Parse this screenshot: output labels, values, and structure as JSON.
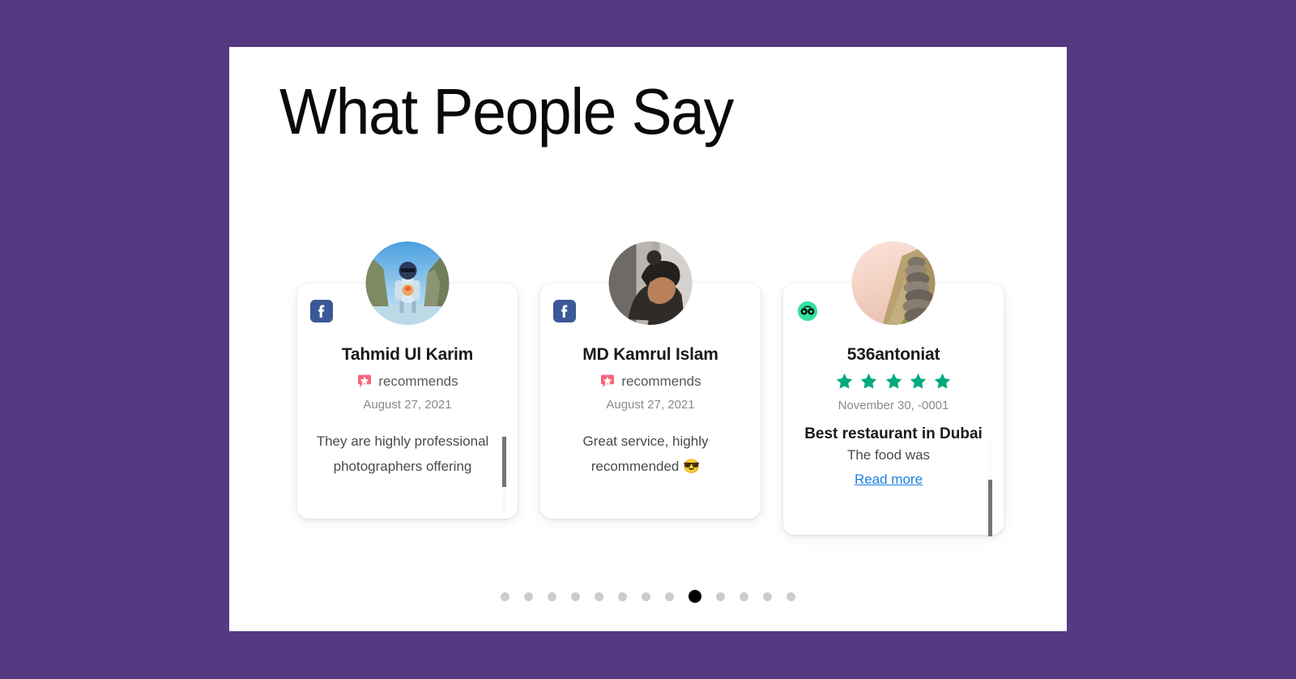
{
  "theme": {
    "background_color": "#553a82",
    "panel_color": "#ffffff",
    "facebook_blue": "#3b5998",
    "tripadvisor_green": "#34e0a1",
    "star_green": "#00a97f",
    "recommend_pink": "#f8657a",
    "link_blue": "#1b7fe0",
    "active_dot_color": "#000000",
    "inactive_dot_color": "#cccccc"
  },
  "header": {
    "title": "What People Say"
  },
  "carousel": {
    "slides": [
      {
        "source": "facebook",
        "source_label": "Facebook",
        "avatar_alt": "Man in sunglasses standing between cliffs",
        "name": "Tahmid Ul Karim",
        "recommends_label": "recommends",
        "date": "August 27, 2021",
        "review_title": "",
        "rating": 0,
        "text": "They are highly professional photographers offering",
        "read_more_label": "",
        "scroll_position": "top"
      },
      {
        "source": "facebook",
        "source_label": "Facebook",
        "avatar_alt": "Man with bun looking down",
        "name": "MD Kamrul Islam",
        "recommends_label": "recommends",
        "date": "August 27, 2021",
        "review_title": "",
        "rating": 0,
        "text": "Great service, highly recommended 😎",
        "read_more_label": "",
        "scroll_position": "top"
      },
      {
        "source": "tripadvisor",
        "source_label": "Tripadvisor",
        "avatar_alt": "Rock cairn on a mountain ridge",
        "name": "536antoniat",
        "recommends_label": "",
        "date": "November 30, -0001",
        "review_title": "Best restaurant in Dubai",
        "rating": 5,
        "text": "restaurant I have ever been. The food was",
        "read_more_label": "Read more",
        "scroll_position": "middle"
      }
    ],
    "pagination": {
      "total": 13,
      "active_index": 8
    }
  }
}
